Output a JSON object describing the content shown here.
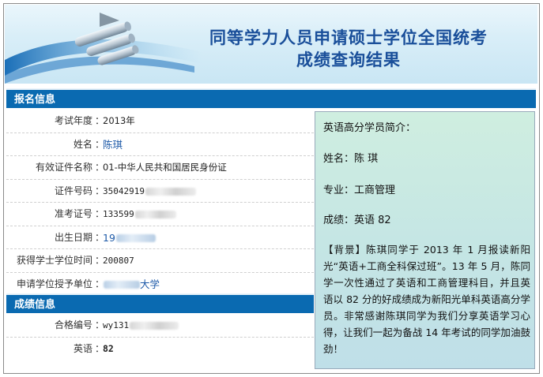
{
  "banner": {
    "title_line1": "同等学力人员申请硕士学位全国统考",
    "title_line2": "成绩查询结果"
  },
  "section_registration": "报名信息",
  "registration": [
    {
      "label": "考试年度",
      "value": "2013年",
      "style": "plain"
    },
    {
      "label": "姓名",
      "value": "陈琪",
      "style": "blue"
    },
    {
      "label": "有效证件名称",
      "value": "01-中华人民共和国居民身份证",
      "style": "plain"
    },
    {
      "label": "证件号码",
      "value": "35042919",
      "style": "mono",
      "blurred": true
    },
    {
      "label": "准考证号",
      "value": "133599",
      "style": "mono",
      "blurred": true
    },
    {
      "label": "出生日期",
      "value": "19",
      "style": "blue",
      "blurred": true
    },
    {
      "label": "获得学士学位时间",
      "value": "200807",
      "style": "mono"
    },
    {
      "label": "申请学位授予单位",
      "value": "大学",
      "style": "blue",
      "blurred_prefix": true
    }
  ],
  "section_scores": "成绩信息",
  "scores": [
    {
      "label": "合格编号",
      "value": "wy131",
      "style": "mono",
      "blurred": true
    },
    {
      "label": "英语",
      "value": "82",
      "style": "bold"
    }
  ],
  "separator": "：",
  "panel": {
    "intro": "英语高分学员简介：",
    "name": "姓名：陈 琪",
    "major": "专业：工商管理",
    "score": "成绩：英语 82",
    "story": "【背景】陈琪同学于 2013 年 1 月报读新阳光“英语+工商全科保过班”。13 年 5 月，陈同学一次性通过了英语和工商管理科目，并且英语以 82 分的好成绩成为新阳光单科英语高分学员。非常感谢陈琪同学为我们分享英语学习心得，让我们一起为备战 14 年考试的同学加油鼓劲！"
  },
  "colors": {
    "bar": "#0a6ab1",
    "title": "#1a4f9a",
    "link_value": "#1e5aa8",
    "panel_green": "#cfeee0",
    "panel_blue": "#bfdfe8"
  }
}
